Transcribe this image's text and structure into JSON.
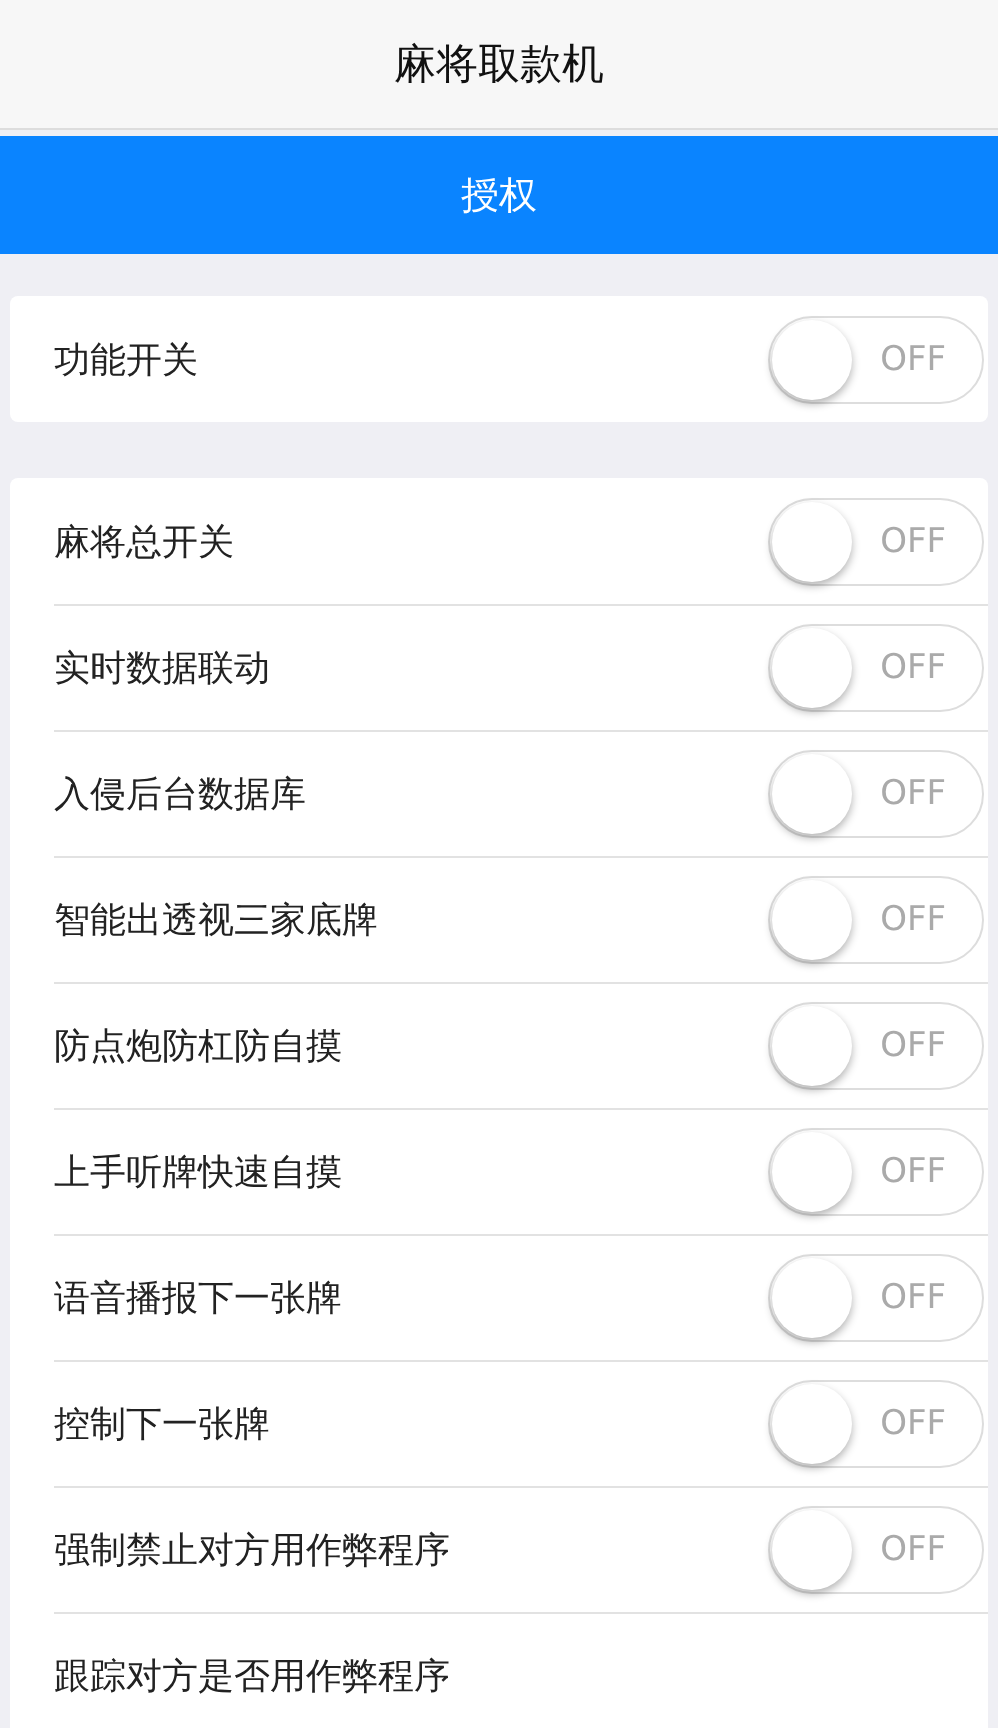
{
  "header": {
    "title": "麻将取款机"
  },
  "authorize_button": {
    "label": "授权"
  },
  "master_section": [
    {
      "label": "功能开关",
      "on": false,
      "switch_text": "OFF"
    }
  ],
  "features": [
    {
      "label": "麻将总开关",
      "on": false,
      "switch_text": "OFF"
    },
    {
      "label": "实时数据联动",
      "on": false,
      "switch_text": "OFF"
    },
    {
      "label": "入侵后台数据库",
      "on": false,
      "switch_text": "OFF"
    },
    {
      "label": "智能出透视三家底牌",
      "on": false,
      "switch_text": "OFF"
    },
    {
      "label": "防点炮防杠防自摸",
      "on": false,
      "switch_text": "OFF"
    },
    {
      "label": "上手听牌快速自摸",
      "on": false,
      "switch_text": "OFF"
    },
    {
      "label": "语音播报下一张牌",
      "on": false,
      "switch_text": "OFF"
    },
    {
      "label": "控制下一张牌",
      "on": false,
      "switch_text": "OFF"
    },
    {
      "label": "强制禁止对方用作弊程序",
      "on": false,
      "switch_text": "OFF"
    },
    {
      "label": "跟踪对方是否用作弊程序"
    }
  ]
}
